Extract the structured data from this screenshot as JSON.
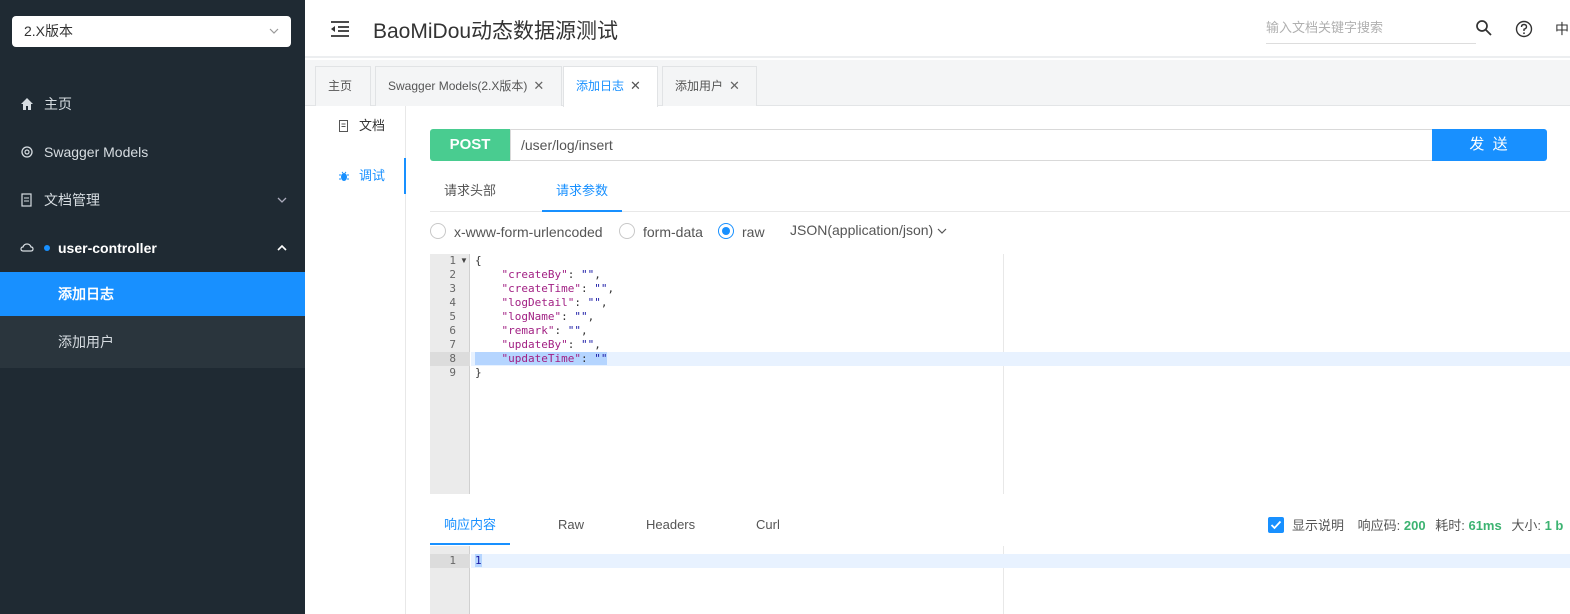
{
  "sidebar": {
    "version_select": "2.X版本",
    "items": [
      {
        "label": "主页",
        "icon": "home-icon"
      },
      {
        "label": "Swagger Models",
        "icon": "gear-icon"
      },
      {
        "label": "文档管理",
        "icon": "document-icon"
      },
      {
        "label": "user-controller",
        "icon": "cloud-icon"
      }
    ],
    "sub_items": [
      {
        "label": "添加日志",
        "active": true
      },
      {
        "label": "添加用户",
        "active": false
      }
    ]
  },
  "header": {
    "title": "BaoMiDou动态数据源测试",
    "search_placeholder": "输入文档关键字搜索",
    "lang": "中"
  },
  "tabs": [
    {
      "label": "主页",
      "closable": false
    },
    {
      "label": "Swagger Models(2.X版本)",
      "closable": true
    },
    {
      "label": "添加日志",
      "closable": true,
      "active": true
    },
    {
      "label": "添加用户",
      "closable": true
    }
  ],
  "rail": [
    {
      "label": "文档",
      "icon": "document-icon"
    },
    {
      "label": "调试",
      "icon": "bug-icon",
      "active": true
    }
  ],
  "request": {
    "method": "POST",
    "url": "/user/log/insert",
    "send_label": "发 送",
    "param_tabs": [
      "请求头部",
      "请求参数"
    ],
    "active_param_tab": "请求参数",
    "body_types": [
      "x-www-form-urlencoded",
      "form-data",
      "raw"
    ],
    "selected_body_type": "raw",
    "content_type": "JSON(application/json)",
    "body_lines": [
      {
        "n": "1",
        "text": "{"
      },
      {
        "n": "2",
        "key": "\"createBy\"",
        "val": "\"\""
      },
      {
        "n": "3",
        "key": "\"createTime\"",
        "val": "\"\""
      },
      {
        "n": "4",
        "key": "\"logDetail\"",
        "val": "\"\""
      },
      {
        "n": "5",
        "key": "\"logName\"",
        "val": "\"\""
      },
      {
        "n": "6",
        "key": "\"remark\"",
        "val": "\"\""
      },
      {
        "n": "7",
        "key": "\"updateBy\"",
        "val": "\"\""
      },
      {
        "n": "8",
        "key": "\"updateTime\"",
        "val": "\"\""
      },
      {
        "n": "9",
        "text": "}"
      }
    ]
  },
  "response": {
    "tabs": [
      "响应内容",
      "Raw",
      "Headers",
      "Curl"
    ],
    "active_tab": "响应内容",
    "show_desc_label": "显示说明",
    "code_label": "响应码:",
    "code": "200",
    "time_label": "耗时:",
    "time": "61ms",
    "size_label": "大小:",
    "size": "1 b",
    "lines": [
      {
        "n": "1",
        "text": "1"
      }
    ]
  },
  "colors": {
    "accent": "#1890ff",
    "post": "#49cc90",
    "sidebar_bg": "#1f2a33"
  }
}
